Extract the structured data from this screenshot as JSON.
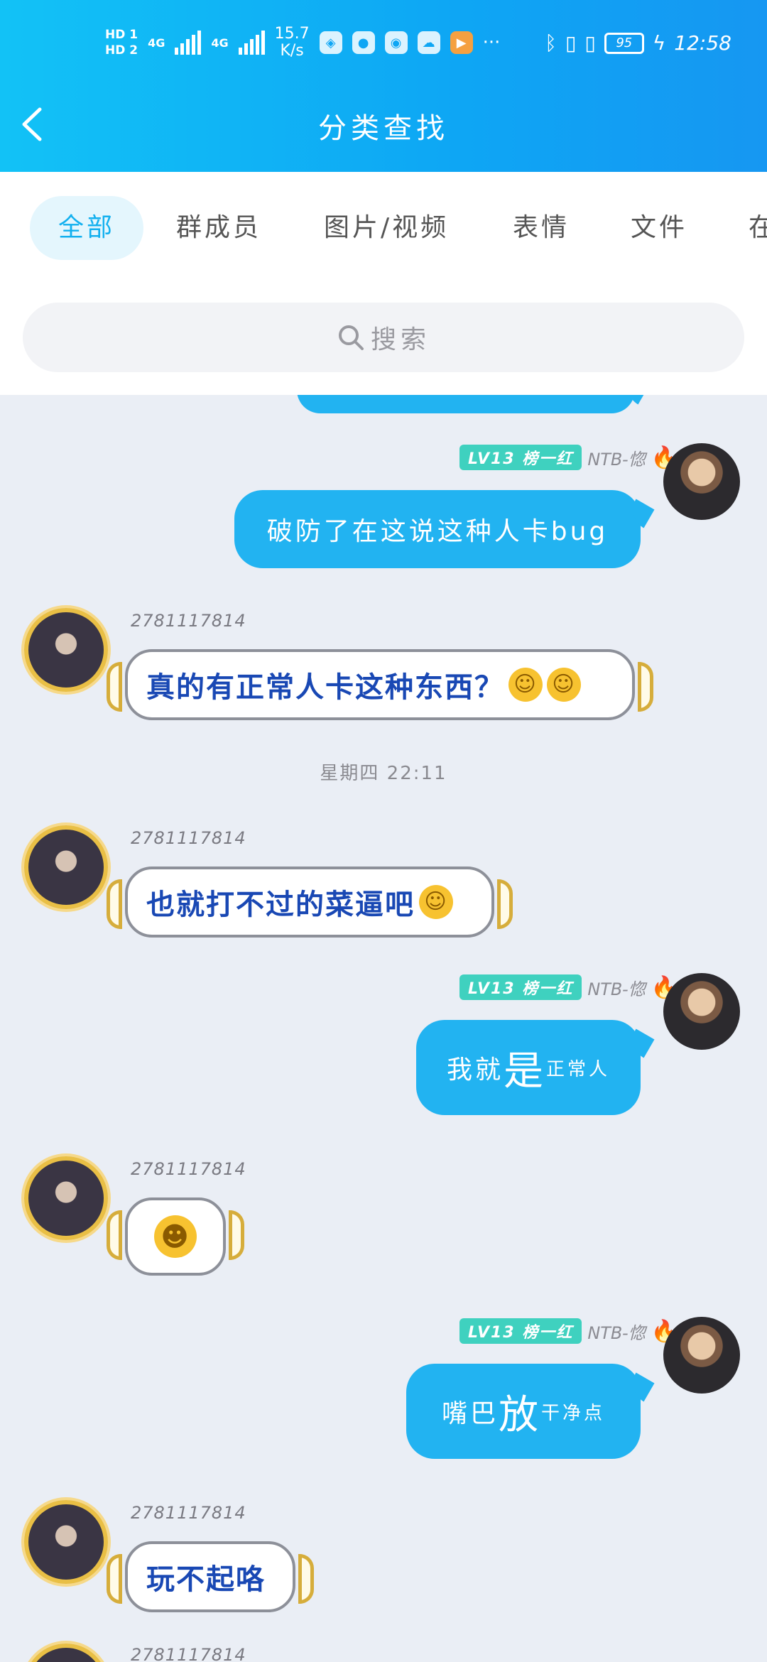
{
  "status_bar": {
    "hd1": "HD 1",
    "hd2": "HD 2",
    "net_type_1": "4G",
    "net_type_2": "4G",
    "speed": "15.7",
    "speed_unit": "K/s",
    "more": "···",
    "battery": "95",
    "time": "12:58"
  },
  "header": {
    "title": "分类查找"
  },
  "tabs": [
    {
      "label": "全部",
      "active": true
    },
    {
      "label": "群成员",
      "active": false
    },
    {
      "label": "图片/视频",
      "active": false
    },
    {
      "label": "表情",
      "active": false
    },
    {
      "label": "文件",
      "active": false
    },
    {
      "label": "在",
      "active": false
    }
  ],
  "search": {
    "placeholder": "搜索"
  },
  "badge": {
    "level": "LV13",
    "title": "榜一红",
    "sender_name": "NTB-惚"
  },
  "other_user": {
    "id": "2781117814"
  },
  "messages": {
    "m1": "破防了在这说这种人卡bug",
    "m2": "真的有正常人卡这种东西？",
    "timestamp": "星期四 22:11",
    "m3": "也就打不过的菜逼吧",
    "m4_a": "我就",
    "m4_b": "是",
    "m4_c": "正常人",
    "m6_a": "嘴巴",
    "m6_b": "放",
    "m6_c": "干净点",
    "m7": "玩不起咯"
  },
  "colors": {
    "accent": "#12b0ef",
    "self_bubble": "#22b3f1",
    "other_text": "#1948b4",
    "badge": "#3fd1bf"
  }
}
